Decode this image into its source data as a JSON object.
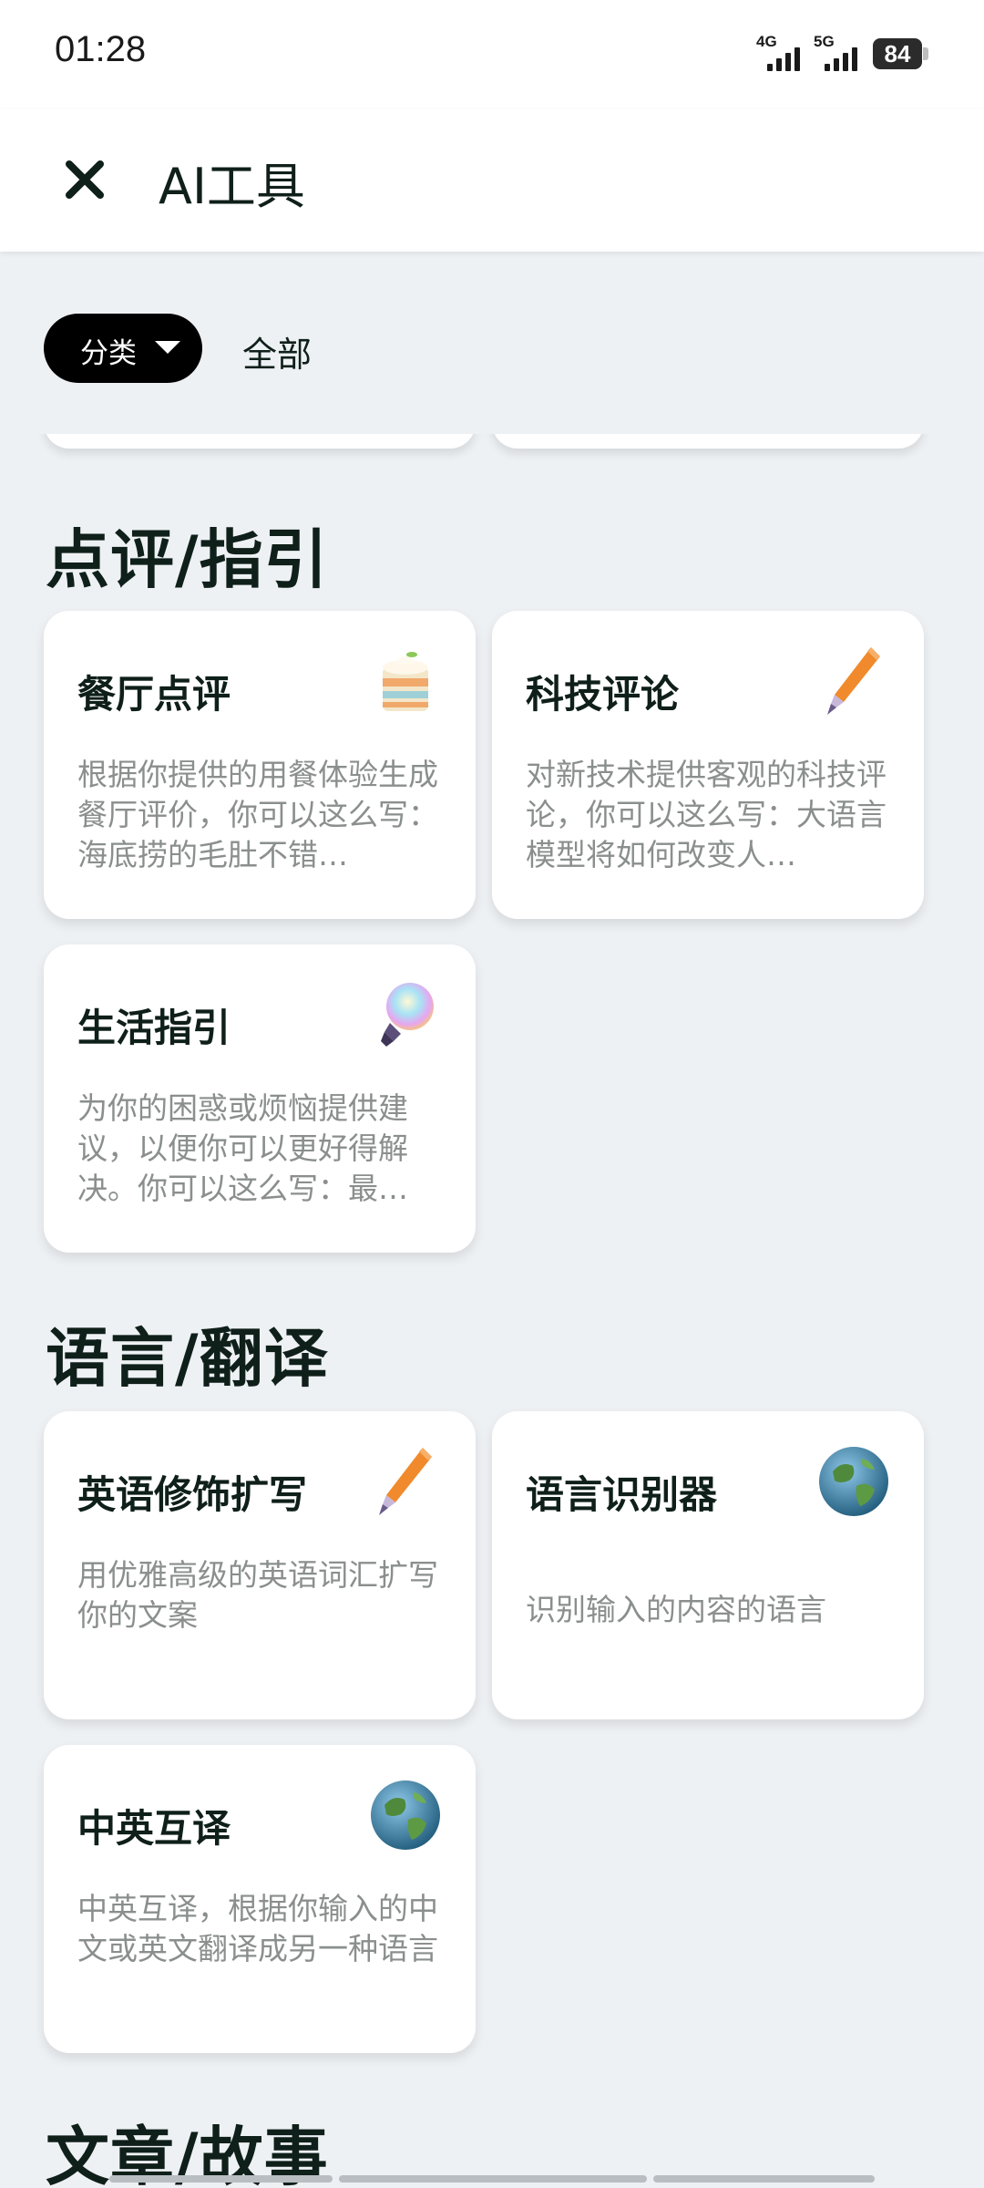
{
  "status_bar": {
    "time": "01:28",
    "net1_label": "4G",
    "net2_label": "5G",
    "battery": "84"
  },
  "header": {
    "title": "AI工具",
    "close_icon": "close-icon"
  },
  "filter": {
    "category_label": "分类",
    "category_icon": "caret-down-icon",
    "selected_value": "全部"
  },
  "sections": [
    {
      "title": "点评/指引",
      "cards": [
        {
          "title": "餐厅点评",
          "description": "根据你提供的用餐体验生成餐厅评价，你可以这么写：海底捞的毛肚不错…",
          "icon": "cake-icon"
        },
        {
          "title": "科技评论",
          "description": "对新技术提供客观的科技评论，你可以这么写：大语言模型将如何改变人…",
          "icon": "pen-icon"
        },
        {
          "title": "生活指引",
          "description": "为你的困惑或烦恼提供建议，以便你可以更好得解决。你可以这么写：最…",
          "icon": "lightbulb-icon"
        }
      ]
    },
    {
      "title": "语言/翻译",
      "cards": [
        {
          "title": "英语修饰扩写",
          "description": "用优雅高级的英语词汇扩写你的文案",
          "icon": "pen-icon"
        },
        {
          "title": "语言识别器",
          "description": "识别输入的内容的语言",
          "icon": "globe-icon"
        },
        {
          "title": "中英互译",
          "description": "中英互译，根据你输入的中文或英文翻译成另一种语言",
          "icon": "globe-icon"
        }
      ]
    },
    {
      "title": "文章/故事",
      "cards": []
    }
  ],
  "colors": {
    "background": "#eef1f4",
    "card": "#ffffff",
    "title": "#0f1f19",
    "description": "#8a8f8d",
    "chip": "#000000"
  }
}
